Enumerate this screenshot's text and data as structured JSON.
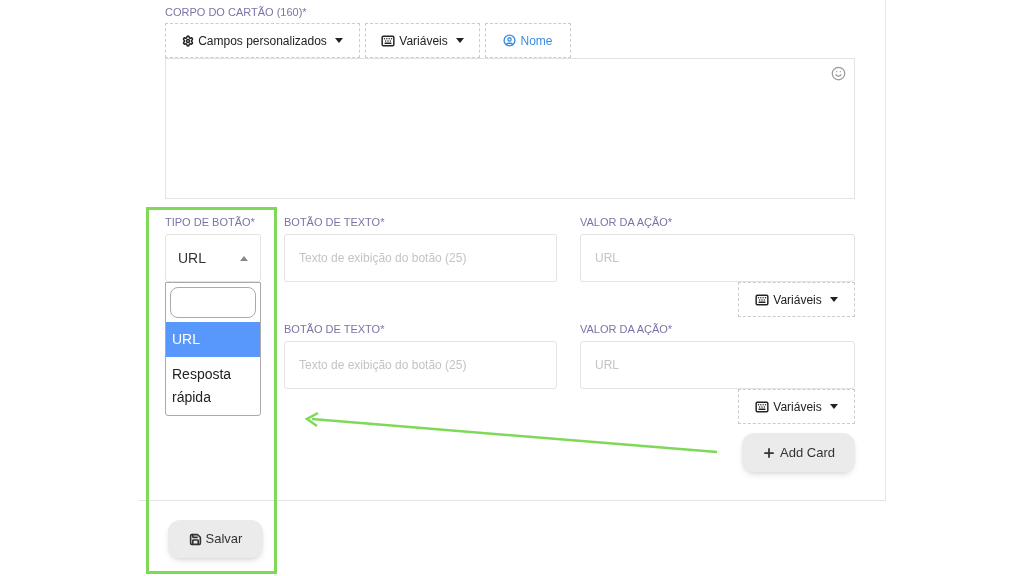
{
  "card_body": {
    "label": "CORPO DO CARTÃO (160)*",
    "toolbar": [
      {
        "kind": "dropdown",
        "label": "Campos personalizados"
      },
      {
        "kind": "dropdown",
        "label": "Variáveis"
      },
      {
        "kind": "link",
        "label": "Nome"
      }
    ]
  },
  "button_rows": [
    {
      "type_label": "TIPO DE BOTÃO*",
      "type_select": {
        "value": "URL",
        "expanded": true,
        "options": [
          {
            "label": "URL",
            "selected": true
          },
          {
            "label": "Resposta rápida",
            "selected": false
          }
        ]
      },
      "text_label": "BOTÃO DE TEXTO*",
      "text_placeholder": "Texto de exibição do botão (25)",
      "action_label": "VALOR DA AÇÃO*",
      "action_placeholder": "URL",
      "variables_button": "Variáveis"
    },
    {
      "text_label": "BOTÃO DE TEXTO*",
      "text_placeholder": "Texto de exibição do botão (25)",
      "action_label": "VALOR DA AÇÃO*",
      "action_placeholder": "URL",
      "variables_button": "Variáveis"
    }
  ],
  "add_card_button": "Add Card",
  "save_button": "Salvar"
}
